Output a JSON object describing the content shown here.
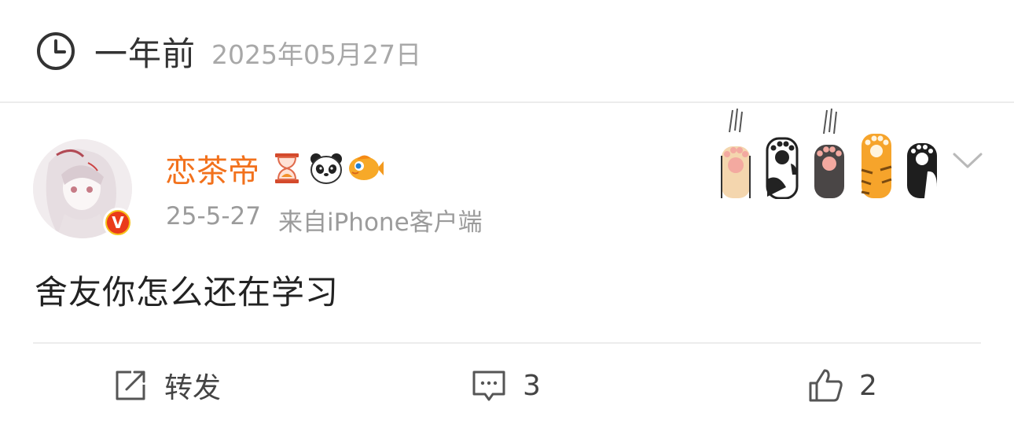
{
  "memory": {
    "relative": "一年前",
    "date": "2025年05月27日",
    "icon": "clock-icon"
  },
  "post": {
    "username": "恋茶帝",
    "badges": [
      "hourglass-icon",
      "panda-icon",
      "fish-icon"
    ],
    "time": "25-5-27",
    "source": "来自iPhone客户端",
    "text": "舍友你怎么还在学习",
    "colors": {
      "username": "#f2711c",
      "verified": "#f6c11b"
    }
  },
  "actions": {
    "repost_label": "转发",
    "comment_count": "3",
    "like_count": "2"
  }
}
